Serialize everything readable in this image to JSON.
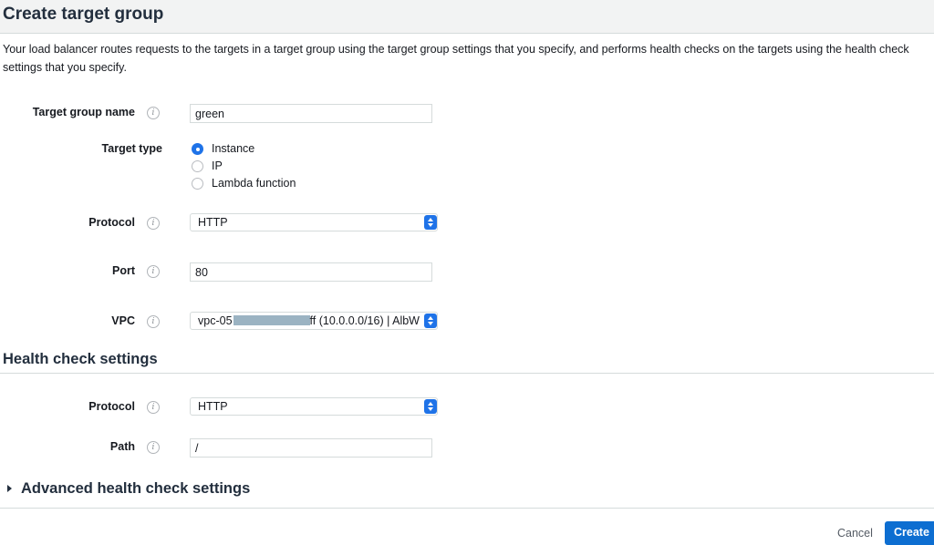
{
  "header": {
    "title": "Create target group"
  },
  "description": "Your load balancer routes requests to the targets in a target group using the target group settings that you specify, and performs health checks on the targets using the health check settings that you specify.",
  "form": {
    "target_group_name": {
      "label": "Target group name",
      "value": "green"
    },
    "target_type": {
      "label": "Target type",
      "options": [
        "Instance",
        "IP",
        "Lambda function"
      ],
      "selected": "Instance"
    },
    "protocol": {
      "label": "Protocol",
      "value": "HTTP"
    },
    "port": {
      "label": "Port",
      "value": "80"
    },
    "vpc": {
      "label": "VPC",
      "value_prefix": "vpc-05",
      "value_suffix": "ff (10.0.0.0/16) | AlbW"
    }
  },
  "health_check": {
    "title": "Health check settings",
    "protocol": {
      "label": "Protocol",
      "value": "HTTP"
    },
    "path": {
      "label": "Path",
      "value": "/"
    }
  },
  "advanced": {
    "title": "Advanced health check settings"
  },
  "footer": {
    "cancel_label": "Cancel",
    "create_label": "Create"
  },
  "colors": {
    "accent": "#1f73e8",
    "header_bg": "#f2f3f3",
    "border": "#d5dbdb"
  }
}
